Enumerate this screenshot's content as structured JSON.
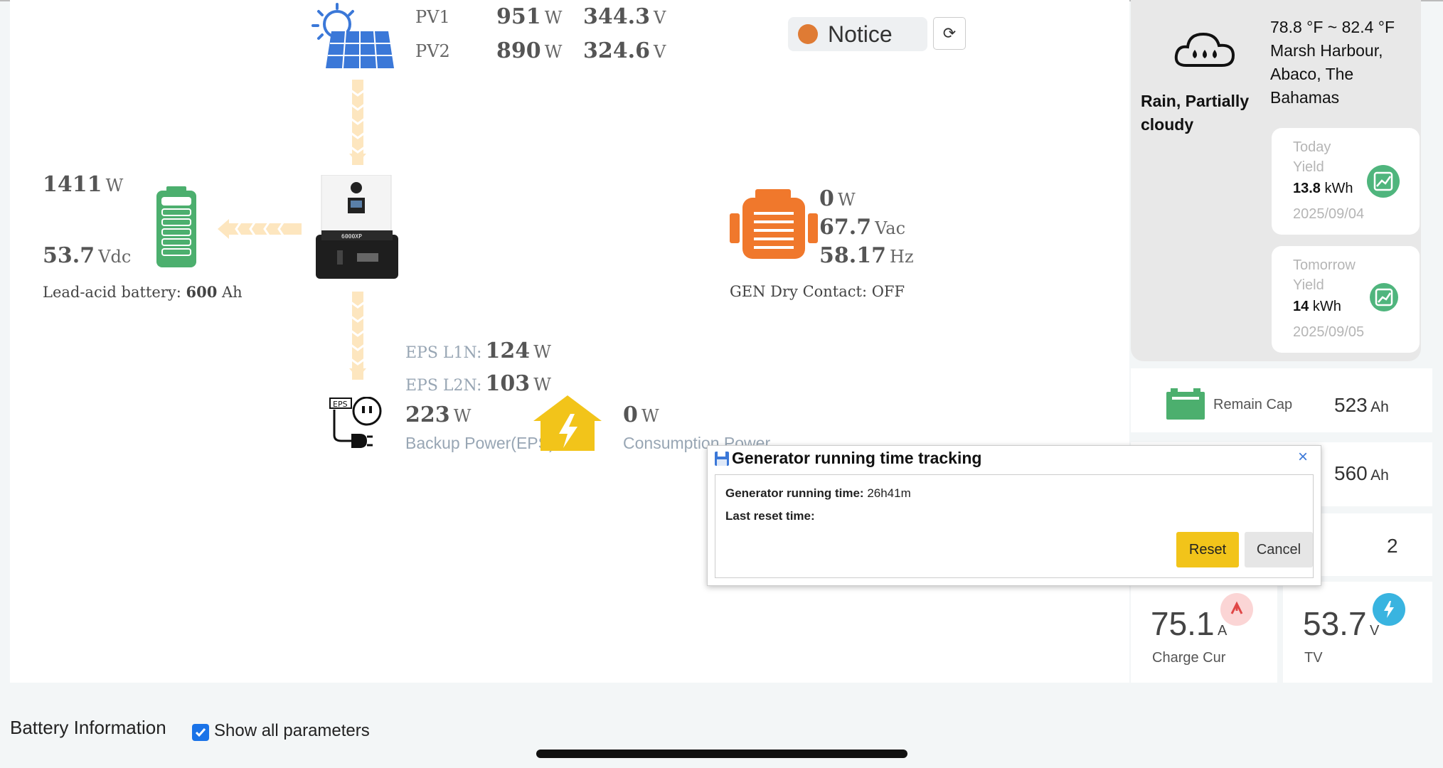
{
  "pv": {
    "rows": [
      {
        "label": "PV1",
        "power": "951",
        "power_unit": "W",
        "voltage": "344.3",
        "voltage_unit": "V"
      },
      {
        "label": "PV2",
        "power": "890",
        "power_unit": "W",
        "voltage": "324.6",
        "voltage_unit": "V"
      }
    ]
  },
  "notice": {
    "label": "Notice",
    "status_color": "#df7b34"
  },
  "battery": {
    "power": "1411",
    "power_unit": "W",
    "voltage": "53.7",
    "voltage_unit": "Vdc",
    "type_label": "Lead-acid battery:",
    "capacity": "600",
    "capacity_unit": "Ah"
  },
  "generator": {
    "power": "0",
    "power_unit": "W",
    "voltage": "67.7",
    "voltage_unit": "Vac",
    "frequency": "58.17",
    "frequency_unit": "Hz",
    "dry_contact": "GEN Dry Contact: OFF"
  },
  "inverter": {
    "model": "6000XP"
  },
  "eps": {
    "l1_label": "EPS L1N:",
    "l1_value": "124",
    "l1_unit": "W",
    "l2_label": "EPS L2N:",
    "l2_value": "103",
    "l2_unit": "W",
    "total": "223",
    "total_unit": "W",
    "label": "Backup Power(EPS)",
    "icon_text": "EPS"
  },
  "consumption": {
    "value": "0",
    "unit": "W",
    "label": "Consumption Power"
  },
  "weather": {
    "temp_range": "78.8 °F ~ 82.4 °F",
    "location_line1": "Marsh Harbour,",
    "location_line2": "Abaco, The",
    "location_line3": "Bahamas",
    "condition_line1": "Rain, Partially",
    "condition_line2": "cloudy",
    "today": {
      "label1": "Today",
      "label2": "Yield",
      "value": "13.8",
      "unit": "kWh",
      "date": "2025/09/04"
    },
    "tomorrow": {
      "label1": "Tomorrow",
      "label2": "Yield",
      "value": "14",
      "unit": "kWh",
      "date": "2025/09/05"
    }
  },
  "stats": {
    "remain_cap_label": "Remain Cap",
    "remain_cap_value": "523",
    "remain_cap_unit": "Ah",
    "second_value": "560",
    "second_unit": "Ah",
    "third_value": "2",
    "charge_cur_value": "75.1",
    "charge_cur_unit": "A",
    "charge_cur_label": "Charge Cur",
    "tv_value": "53.7",
    "tv_unit": "V",
    "tv_label": "TV"
  },
  "modal": {
    "title": "Generator running time tracking",
    "close": "×",
    "running_label": "Generator running time:",
    "running_value": "26h41m",
    "reset_label": "Last reset time:",
    "reset_button": "Reset",
    "cancel_button": "Cancel"
  },
  "footer": {
    "section_title": "Battery Information",
    "show_all_label": "Show all parameters",
    "show_all_checked": true
  },
  "colors": {
    "battery_green": "#4caf6e",
    "generator_orange": "#f0782c",
    "house_yellow": "#f2c41a",
    "arrow_peach": "#fde6bf",
    "solar_blue": "#3b78d8",
    "checkbox_blue": "#1a73e8"
  }
}
